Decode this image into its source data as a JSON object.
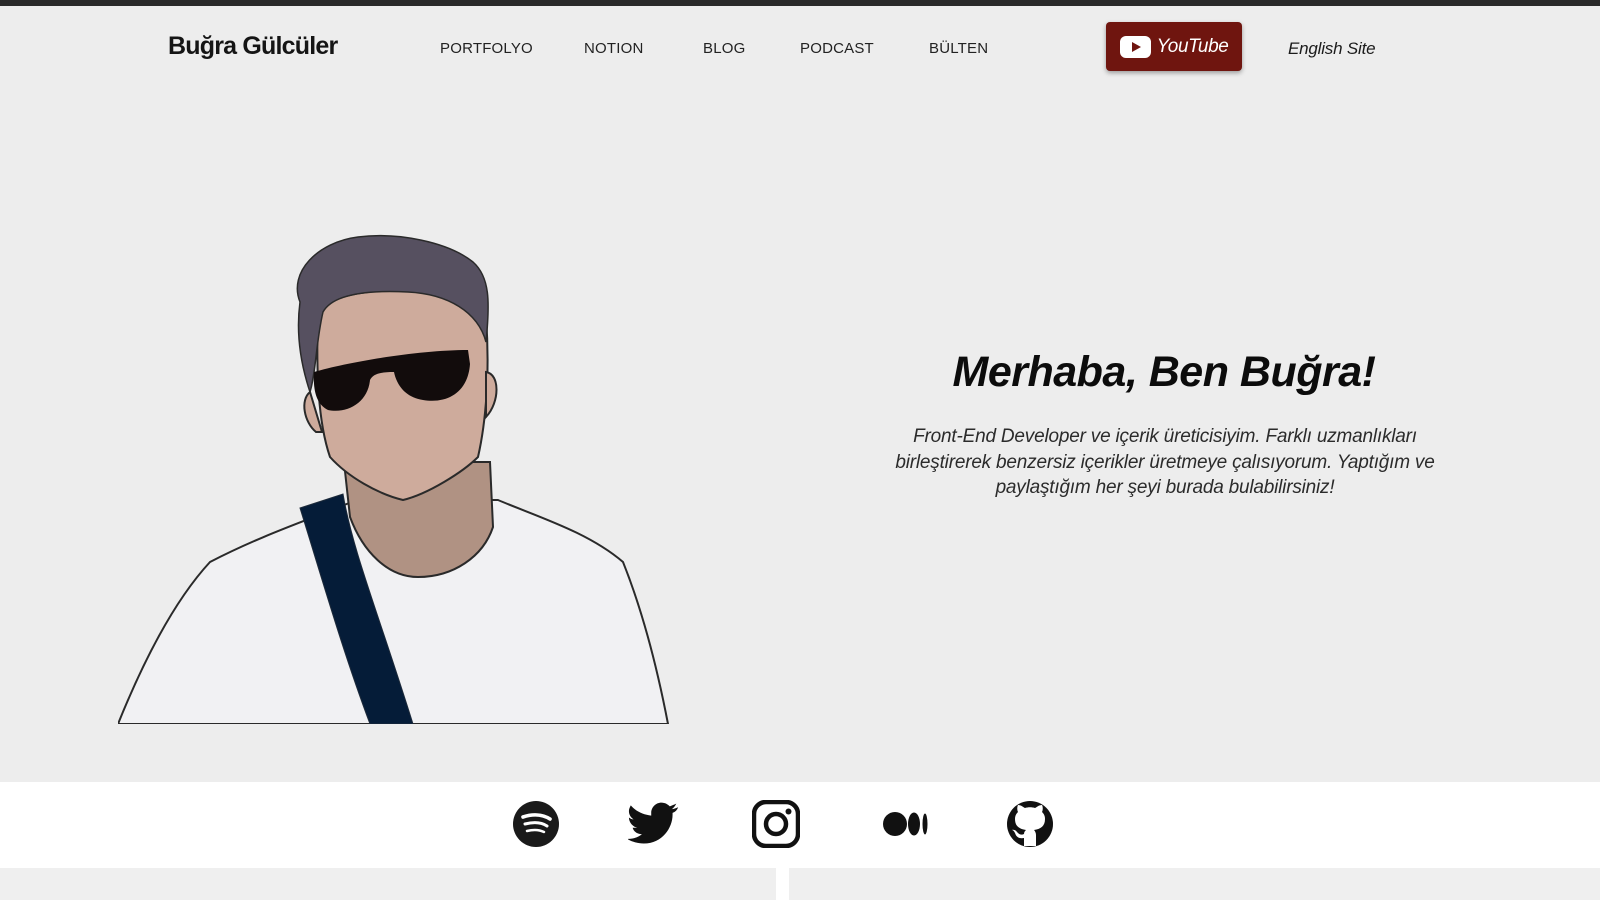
{
  "brand": {
    "name": "Buğra Gülcüler"
  },
  "nav": {
    "items": [
      {
        "label": "PORTFOLYO"
      },
      {
        "label": "NOTION"
      },
      {
        "label": "BLOG"
      },
      {
        "label": "PODCAST"
      },
      {
        "label": "BÜLTEN"
      }
    ],
    "youtube_label": "YouTube",
    "language_link": "English Site"
  },
  "hero": {
    "title": "Merhaba, Ben Buğra!",
    "description": "Front-End Developer ve içerik üreticisiyim. Farklı uzmanlıkları birleştirerek benzersiz içerikler üretmeye çalısıyorum. Yaptığım ve paylaştığım her şeyi burada bulabilirsiniz!"
  },
  "social": {
    "icons": [
      "spotify-icon",
      "twitter-icon",
      "instagram-icon",
      "medium-icon",
      "github-icon"
    ]
  },
  "colors": {
    "background": "#ededed",
    "youtube_button": "#6f150f",
    "social_band": "#ffffff"
  }
}
